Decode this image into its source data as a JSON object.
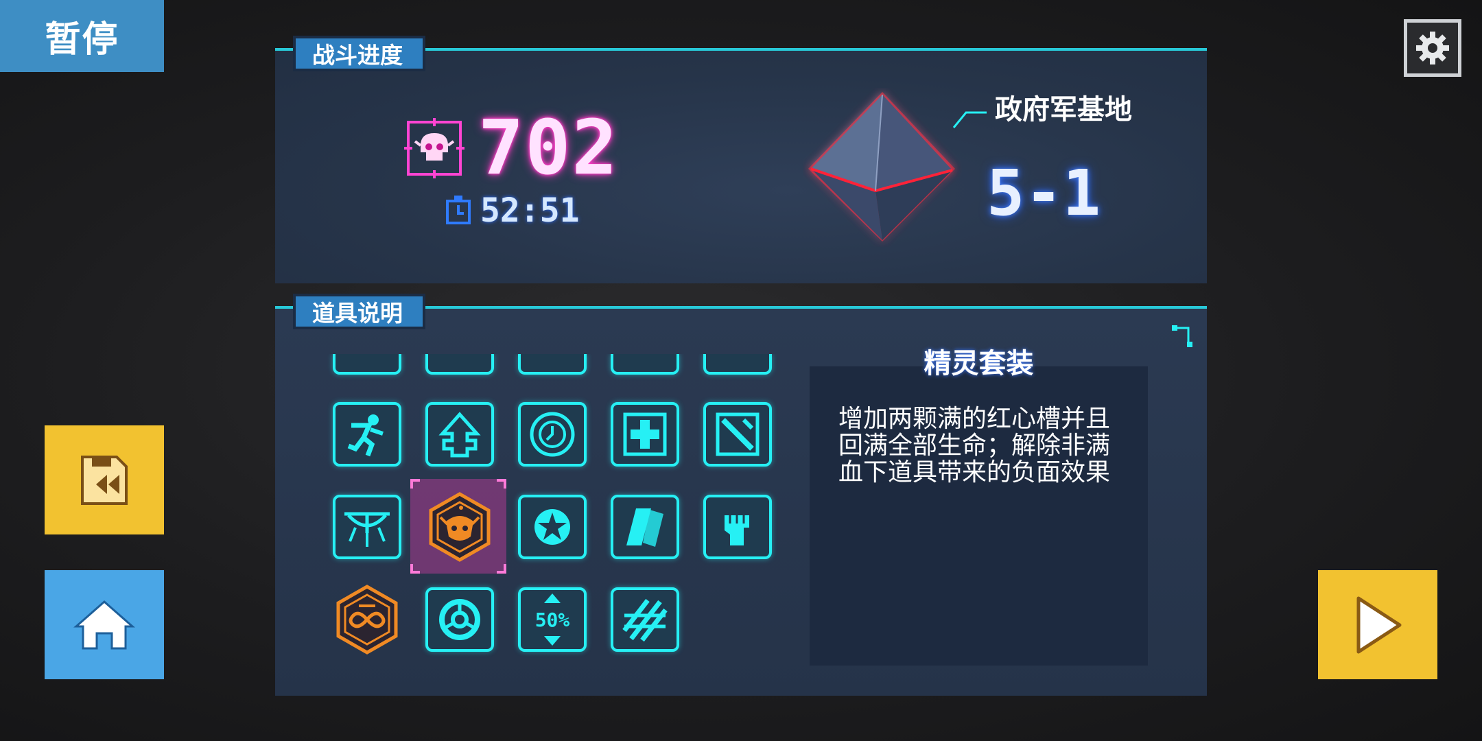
{
  "pause": {
    "label": "暂停"
  },
  "battle": {
    "tab_label": "战斗进度",
    "kill_count": "702",
    "timer": "52:51",
    "location": "政府军基地",
    "stage": "5-1"
  },
  "items": {
    "tab_label": "道具说明",
    "selected": {
      "title": "精灵套装",
      "description": "增加两颗满的红心槽并且回满全部生命；解除非满血下道具带来的负面效果"
    },
    "grid_icons": [
      [
        "partial-icon",
        "partial-icon",
        "partial-icon",
        "partial-icon",
        "partial-icon"
      ],
      [
        "running-man-icon",
        "arrow-up-plus-icon",
        "clock-target-icon",
        "medical-plus-icon",
        "sword-crate-icon"
      ],
      [
        "eye-icon",
        "elf-face-icon",
        "star-compass-icon",
        "cards-icon",
        "fist-icon"
      ],
      [
        "infinity-hex-icon",
        "ring-icon",
        "fifty-percent-icon",
        "lattice-icon"
      ]
    ],
    "fifty_label": "50%"
  },
  "colors": {
    "neon_cyan": "#26f0f4",
    "neon_pink": "#ff3fc8",
    "accent_yellow": "#f2c230",
    "accent_blue": "#4aa6e6",
    "tab_blue": "#2e7fc0",
    "orange": "#f08a24"
  }
}
